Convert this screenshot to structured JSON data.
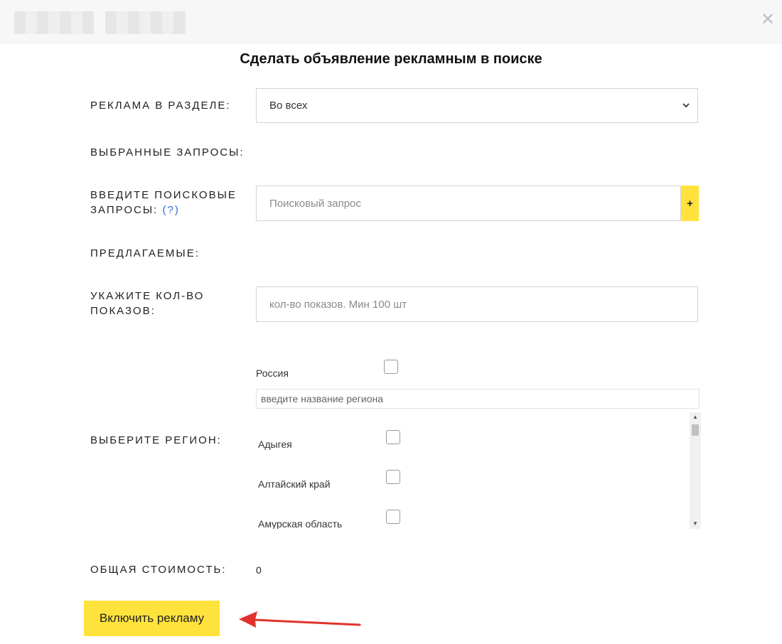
{
  "title": "Сделать объявление рекламным в поиске",
  "section": {
    "label": "Реклама в разделе:",
    "selected": "Во всех"
  },
  "selected_queries": {
    "label": "Выбранные запросы:"
  },
  "search_queries": {
    "label": "Введите поисковые запросы:",
    "help": "(?)",
    "placeholder": "Поисковый запрос",
    "add_label": "+"
  },
  "suggested": {
    "label": "Предлагаемые:"
  },
  "impressions": {
    "label": "Укажите кол-во показов:",
    "placeholder": "кол-во показов. Мин 100 шт"
  },
  "region": {
    "label": "Выберите регион:",
    "country": "Россия",
    "search_placeholder": "введите название региона",
    "items": [
      "Адыгея",
      "Алтайский край",
      "Амурская область"
    ]
  },
  "total": {
    "label": "Общая стоимость:",
    "value": "0"
  },
  "submit_label": "Включить рекламу",
  "colors": {
    "accent": "#ffe33c",
    "annotation_arrow": "#e0332e"
  }
}
